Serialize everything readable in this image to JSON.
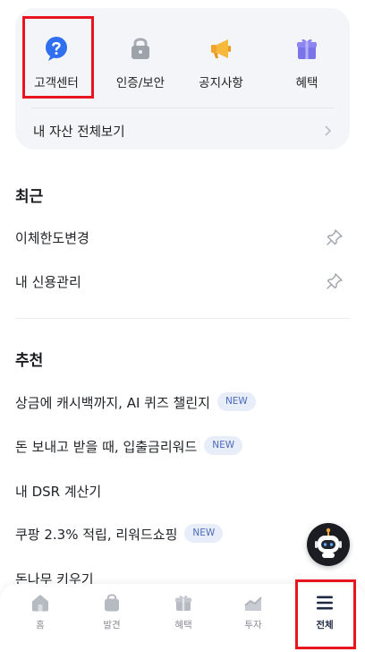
{
  "quick_menu": {
    "items": [
      {
        "label": "고객센터",
        "icon": "question-bubble-icon"
      },
      {
        "label": "인증/보안",
        "icon": "lock-icon"
      },
      {
        "label": "공지사항",
        "icon": "megaphone-icon"
      },
      {
        "label": "혜택",
        "icon": "gift-icon"
      }
    ],
    "assets_link": "내 자산 전체보기"
  },
  "recent": {
    "heading": "최근",
    "items": [
      {
        "label": "이체한도변경"
      },
      {
        "label": "내 신용관리"
      }
    ]
  },
  "recommended": {
    "heading": "추천",
    "badge": "NEW",
    "items": [
      {
        "label": "상금에 캐시백까지, AI 퀴즈 챌린지",
        "is_new": true
      },
      {
        "label": "돈 보내고 받을 때, 입출금리워드",
        "is_new": true
      },
      {
        "label": "내 DSR 계산기",
        "is_new": false
      },
      {
        "label": "쿠팡 2.3% 적립, 리워드쇼핑",
        "is_new": true
      },
      {
        "label": "돈나무 키우기",
        "is_new": false
      }
    ]
  },
  "tabbar": {
    "tabs": [
      {
        "label": "홈",
        "icon": "home-icon",
        "active": false
      },
      {
        "label": "발견",
        "icon": "shopping-bag-icon",
        "active": false
      },
      {
        "label": "혜택",
        "icon": "gift-icon",
        "active": false
      },
      {
        "label": "투자",
        "icon": "chart-icon",
        "active": false
      },
      {
        "label": "전체",
        "icon": "menu-icon",
        "active": true
      }
    ]
  },
  "colors": {
    "accent_blue": "#2f6ff0",
    "highlight_red": "#e8141e",
    "card_bg": "#f4f5f8",
    "new_badge_bg": "#e8edfa"
  }
}
